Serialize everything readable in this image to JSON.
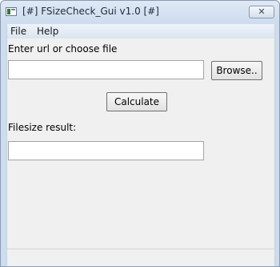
{
  "window": {
    "title": "[#] FSizeCheck_Gui v1.0 [#]",
    "close_glyph": "✕"
  },
  "menu": {
    "file": "File",
    "help": "Help"
  },
  "url_section": {
    "label": "Enter url or choose file",
    "value": "",
    "browse_label": "Browse.."
  },
  "calculate_label": "Calculate",
  "result_section": {
    "label": "Filesize result:",
    "value": ""
  },
  "status": {
    "text": ""
  },
  "icons": {
    "app": "app-window-icon",
    "close": "close-icon"
  }
}
